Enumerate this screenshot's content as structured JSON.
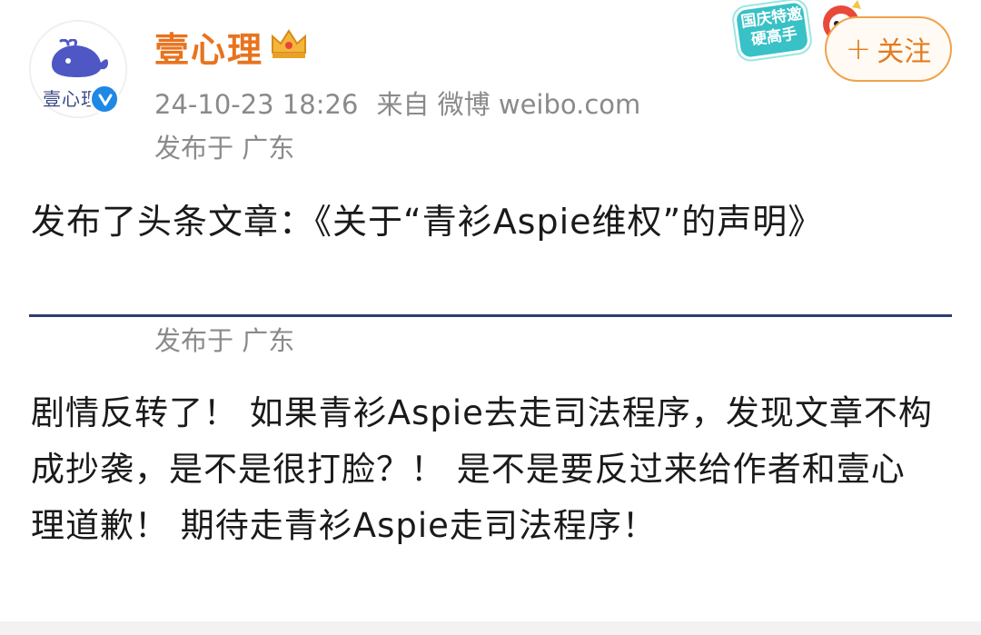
{
  "profile": {
    "avatar_label": "壹心理",
    "username": "壹心理",
    "timestamp": "24-10-23 18:26",
    "source": "来自 微博 weibo.com",
    "location": "发布于 广东"
  },
  "badge": {
    "text": "国庆特邀硬高手"
  },
  "follow": {
    "label": "关注"
  },
  "post": {
    "text": "发布了头条文章：《关于“青衫Aspie维权”的声明》"
  },
  "comment": {
    "location": "发布于 广东",
    "text": "剧情反转了！ 如果青衫Aspie去走司法程序，发现文章不构成抄袭，是不是很打脸？！ 是不是要反过来给作者和壹心理道歉！ 期待走青衫Aspie走司法程序！"
  },
  "colors": {
    "username": "#e8731e",
    "follow_border": "#f0a24a",
    "divider": "#2d3c74",
    "verified": "#1e88e5",
    "meta_gray": "#8a8a8a"
  },
  "icons": [
    "whale-logo-icon",
    "verified-icon",
    "crown-icon",
    "plus-icon",
    "mascot-icon"
  ]
}
